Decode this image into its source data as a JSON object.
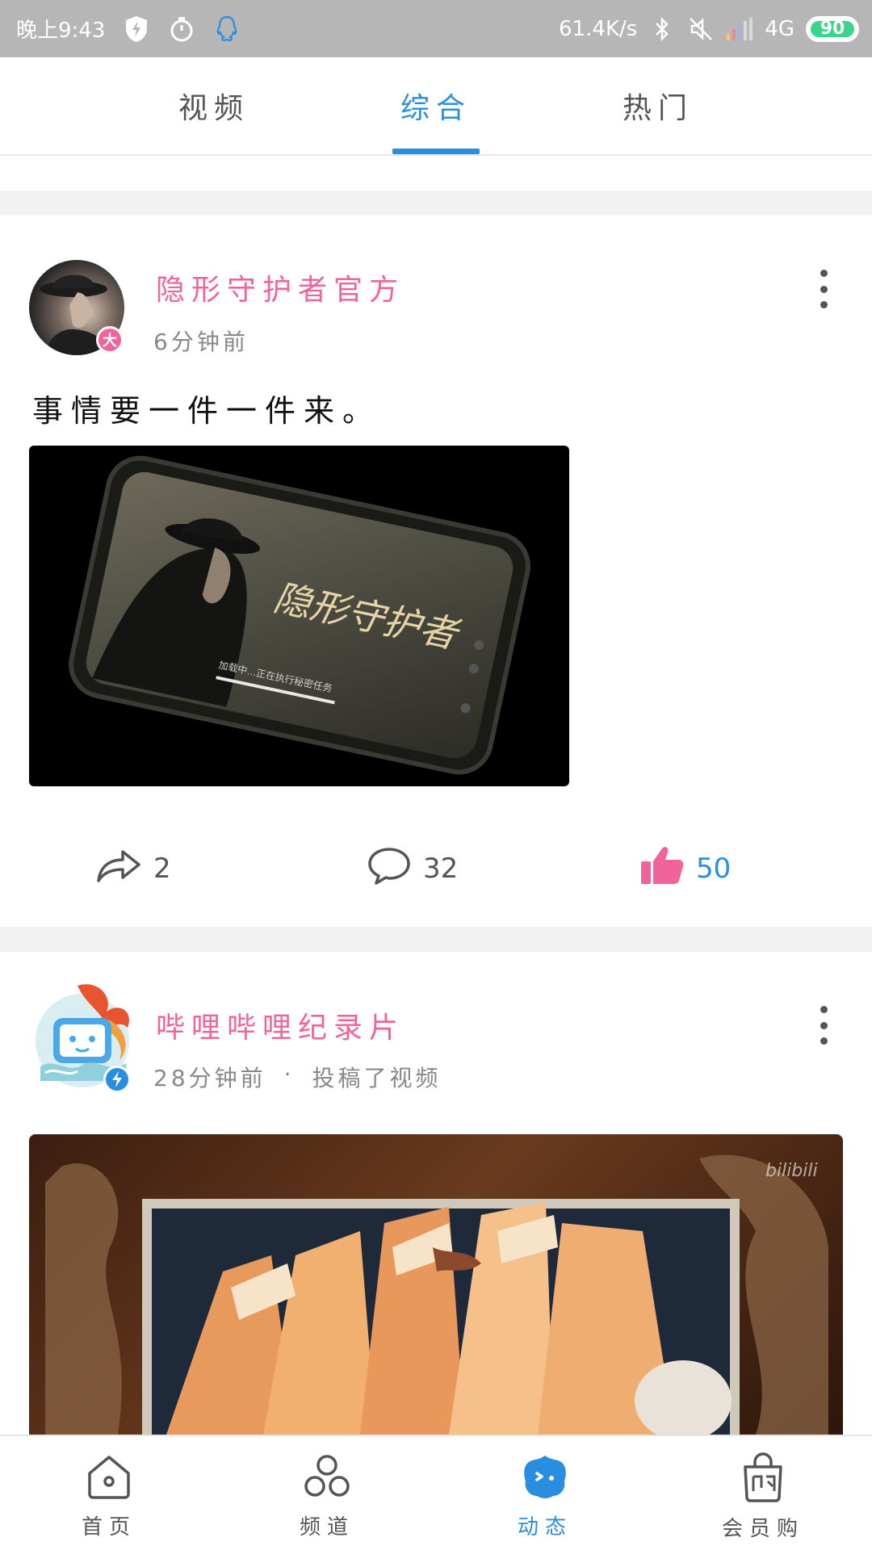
{
  "status_bar": {
    "time": "晚上9:43",
    "net_speed": "61.4K/s",
    "network_type": "4G",
    "battery": "90"
  },
  "tabs": [
    {
      "label": "视频",
      "active": false
    },
    {
      "label": "综合",
      "active": true
    },
    {
      "label": "热门",
      "active": false
    }
  ],
  "posts": [
    {
      "author": "隐形守护者官方",
      "time": "6分钟前",
      "badge": "大",
      "text": "事情要一件一件来。",
      "media_title": "隐形守护者",
      "media_subtitle": "加载中...正在执行秘密任务",
      "actions": {
        "share": "2",
        "comment": "32",
        "like": "50"
      }
    },
    {
      "author": "哔哩哔哩纪录片",
      "time": "28分钟前",
      "separator": "·",
      "activity": "投稿了视频",
      "watermark": "bilibili"
    }
  ],
  "bottom_nav": [
    {
      "label": "首页",
      "icon": "home-icon",
      "active": false
    },
    {
      "label": "频道",
      "icon": "channel-icon",
      "active": false
    },
    {
      "label": "动态",
      "icon": "dynamic-icon",
      "active": true
    },
    {
      "label": "会员购",
      "icon": "shop-bag-icon",
      "active": false
    }
  ],
  "colors": {
    "accent": "#2a8ee0",
    "author_pink": "#f0639b",
    "status_bar": "#b6b6b6"
  }
}
